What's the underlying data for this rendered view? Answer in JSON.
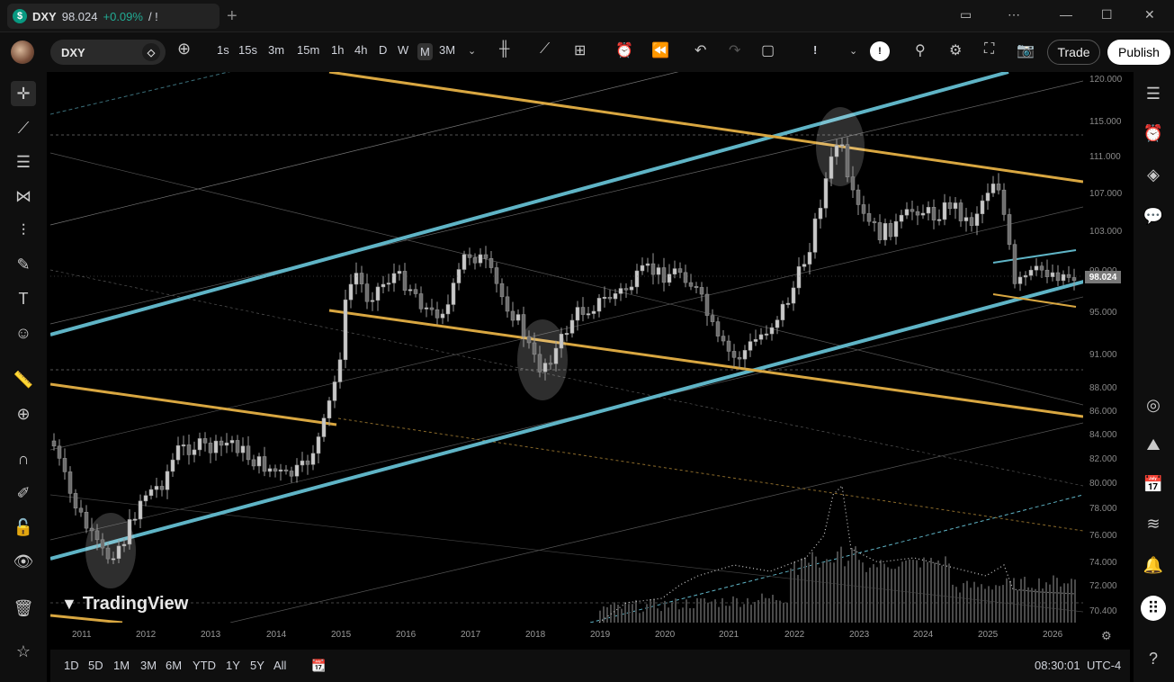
{
  "window": {
    "tab_symbol": "DXY",
    "tab_price": "98.024",
    "tab_change": "+0.09%",
    "tab_suffix": "/ !",
    "new_tab_glyph": "+"
  },
  "toolbar": {
    "symbol": "DXY",
    "timeframes": [
      "1s",
      "15s",
      "3m",
      "15m",
      "1h",
      "4h",
      "D",
      "W",
      "M",
      "3M"
    ],
    "active_timeframe": "M",
    "alert_glyph": "!",
    "trade_label": "Trade",
    "publish_label": "Publish"
  },
  "price_axis": {
    "ticks": [
      "120.000",
      "115.000",
      "111.000",
      "107.000",
      "103.000",
      "99.000",
      "95.000",
      "91.000",
      "88.000",
      "86.000",
      "84.000",
      "82.000",
      "80.000",
      "78.000",
      "76.000",
      "74.000",
      "72.000",
      "70.400"
    ],
    "current_price": "98.024"
  },
  "time_axis": {
    "ticks": [
      "2011",
      "2012",
      "2013",
      "2014",
      "2015",
      "2016",
      "2017",
      "2018",
      "2019",
      "2020",
      "2021",
      "2022",
      "2023",
      "2024",
      "2025",
      "2026"
    ]
  },
  "bottom_bar": {
    "ranges": [
      "1D",
      "5D",
      "1M",
      "3M",
      "6M",
      "YTD",
      "1Y",
      "5Y",
      "All"
    ],
    "clock": "08:30:01",
    "timezone": "UTC-4"
  },
  "watermark": "TradingView",
  "colors": {
    "teal_channel": "#5fb4c6",
    "orange_channel": "#d9a741",
    "positive": "#22ab94",
    "candle": "#b2b2b2"
  }
}
